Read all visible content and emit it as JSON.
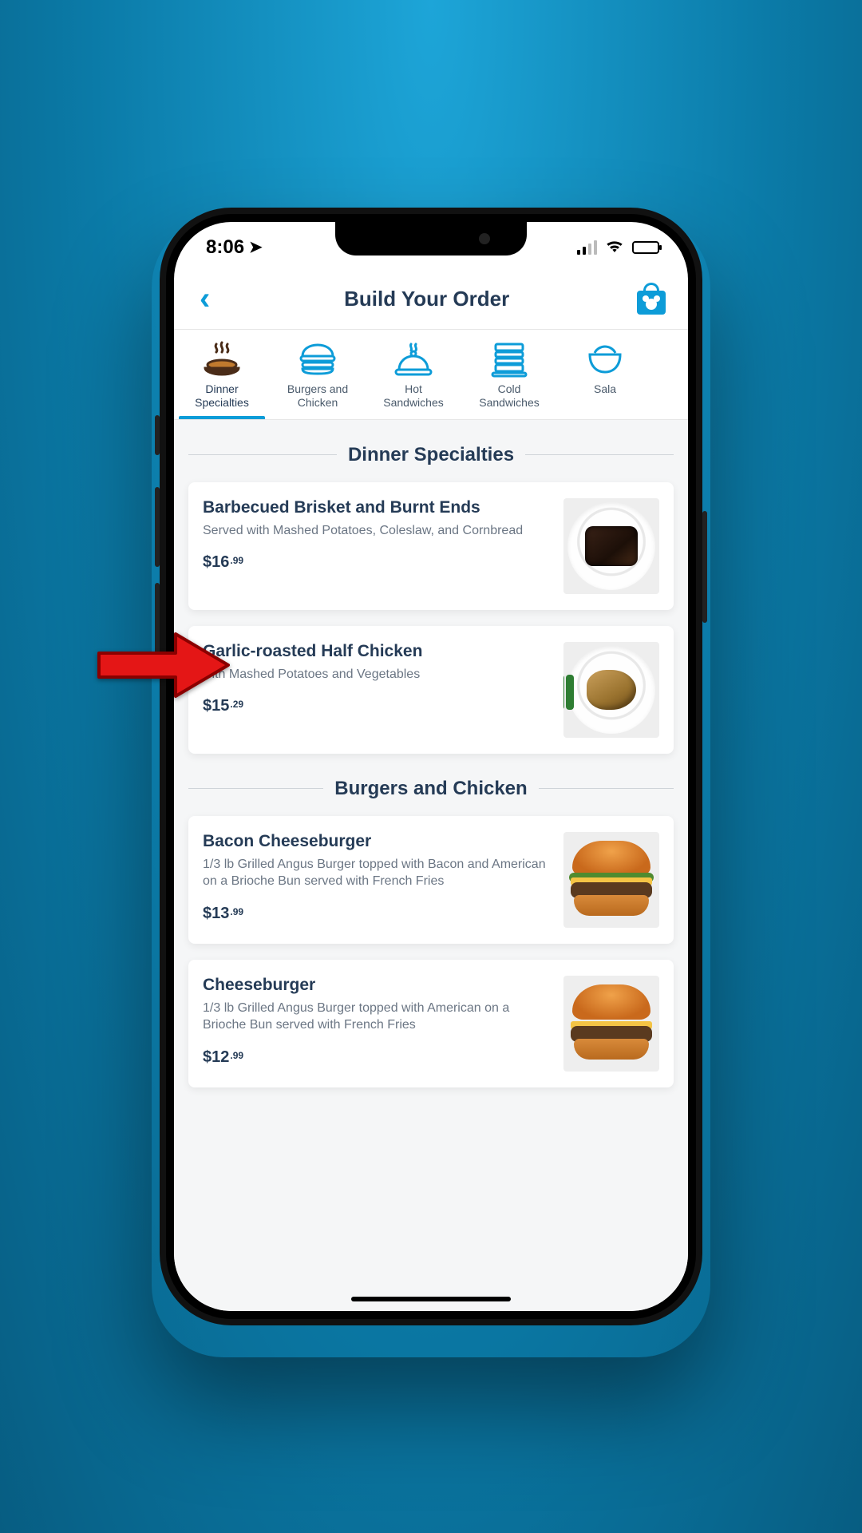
{
  "status": {
    "time": "8:06"
  },
  "header": {
    "title": "Build Your Order"
  },
  "tabs": [
    {
      "label_l1": "Dinner",
      "label_l2": "Specialties",
      "icon": "dish-steam",
      "active": true
    },
    {
      "label_l1": "Burgers and",
      "label_l2": "Chicken",
      "icon": "burger",
      "active": false
    },
    {
      "label_l1": "Hot",
      "label_l2": "Sandwiches",
      "icon": "cloche",
      "active": false
    },
    {
      "label_l1": "Cold",
      "label_l2": "Sandwiches",
      "icon": "stack",
      "active": false
    },
    {
      "label_l1": "Sala",
      "label_l2": "",
      "icon": "bowl",
      "active": false
    }
  ],
  "sections": [
    {
      "title": "Dinner Specialties",
      "items": [
        {
          "name": "Barbecued Brisket and Burnt Ends",
          "desc": "Served with Mashed Potatoes, Coleslaw, and Cornbread",
          "price_whole": "$16",
          "price_cents": ".99",
          "img": "brisket"
        },
        {
          "name": "Garlic-roasted Half Chicken",
          "desc": "with Mashed Potatoes and Vegetables",
          "price_whole": "$15",
          "price_cents": ".29",
          "img": "chicken"
        }
      ]
    },
    {
      "title": "Burgers and Chicken",
      "items": [
        {
          "name": "Bacon Cheeseburger",
          "desc": "1/3 lb Grilled Angus Burger topped with Bacon and American on a Brioche Bun served with French Fries",
          "price_whole": "$13",
          "price_cents": ".99",
          "img": "burger-bacon"
        },
        {
          "name": "Cheeseburger",
          "desc": "1/3 lb Grilled Angus Burger topped with American on a Brioche Bun served with French Fries",
          "price_whole": "$12",
          "price_cents": ".99",
          "img": "burger-plain"
        }
      ]
    }
  ],
  "annotation": {
    "points_to": "menu-item-0-0"
  }
}
